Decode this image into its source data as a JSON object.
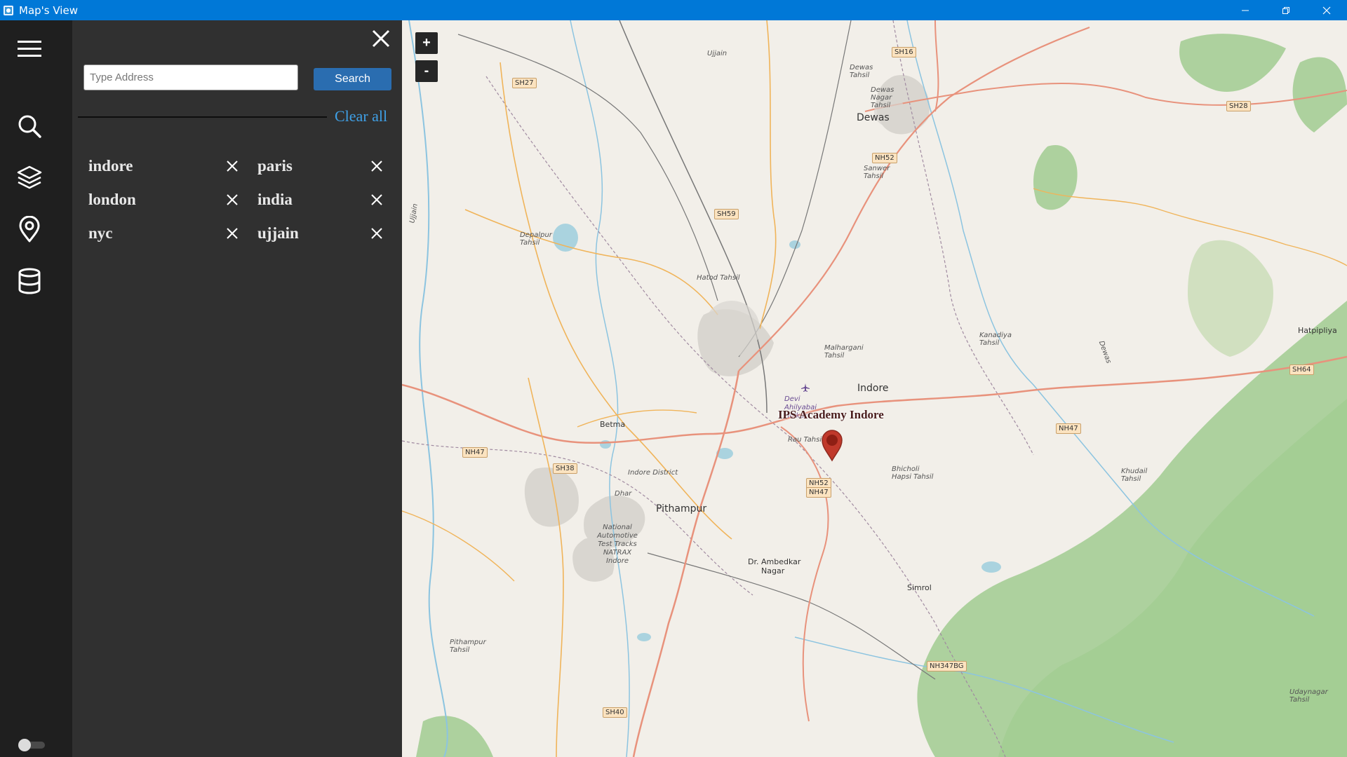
{
  "window": {
    "title": "Map's View"
  },
  "sidebar": {
    "items": [
      {
        "name": "menu"
      },
      {
        "name": "search"
      },
      {
        "name": "layers"
      },
      {
        "name": "location"
      },
      {
        "name": "database"
      }
    ]
  },
  "search_panel": {
    "address_placeholder": "Type Address",
    "address_value": "",
    "search_label": "Search",
    "clear_all_label": "Clear all",
    "history": [
      "indore",
      "paris",
      "london",
      "india",
      "nyc",
      "ujjain"
    ]
  },
  "map": {
    "zoom_in_label": "+",
    "zoom_out_label": "-",
    "marker_label": "IPS Academy Indore",
    "marker_color": "#c0392b",
    "places": {
      "indore": "Indore",
      "dewas": "Dewas",
      "pithampur": "Pithampur",
      "betma": "Betma",
      "simrol": "Simrol",
      "hatpipliya": "Hatpipliya",
      "dr_ambedkar": "Dr. Ambedkar",
      "nagar": "Nagar",
      "ujjain": "Ujjain",
      "dhar": "Dhar",
      "indore_district": "Indore District",
      "dewas_tahsil": "Dewas Tahsil",
      "dewas_nagar_tahsil": "Dewas Nagar Tahsil",
      "sanwer_tahsil": "Sanwer Tahsil",
      "depalpur_tahsil": "Depalpur Tahsil",
      "hatod_tahsil": "Hatod Tahsil",
      "malhargani_tahsil": "Malhargani Tahsil",
      "kanadiya_tahsil": "Kanadiya Tahsil",
      "rau_tahsil": "Rau Tahsil",
      "bhicholi_hapsi_tahsil": "Bhicholi Hapsi Tahsil",
      "khudail_tahsil": "Khudail Tahsil",
      "pithampur_tahsil": "Pithampur Tahsil",
      "udaynagar_tahsil": "Udaynagar Tahsil",
      "natrax": "National Automotive Test Tracks NATRAX Indore",
      "airport": "Devi Ahilyabai Holkar",
      "ujjain_river": "Ujjain",
      "dewas_river": "Dewas"
    },
    "road_shields": [
      "SH27",
      "SH16",
      "SH28",
      "NH52",
      "SH59",
      "SH64",
      "NH47",
      "NH47",
      "SH38",
      "NH52",
      "NH47",
      "SH40",
      "NH347BG"
    ]
  }
}
